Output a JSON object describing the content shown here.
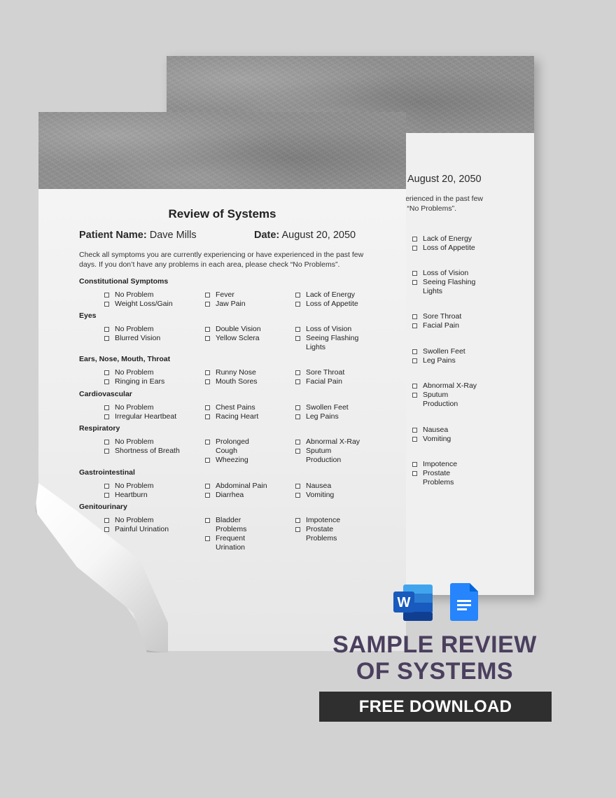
{
  "document": {
    "title": "Review of Systems",
    "patient_label": "Patient Name:",
    "patient_name": "Dave Mills",
    "date_label": "Date:",
    "date_value": "August 20, 2050",
    "instructions_line1": "Check all symptoms you are currently experiencing or have experienced in the past few",
    "instructions_line2": "days. If you don’t have any problems in each area, please check “No Problems”.",
    "sections": [
      {
        "heading": "Constitutional Symptoms",
        "col1": [
          "No Problem",
          "Weight Loss/Gain"
        ],
        "col2": [
          "Fever",
          "Jaw Pain"
        ],
        "col3": [
          "Lack of Energy",
          "Loss of Appetite"
        ]
      },
      {
        "heading": "Eyes",
        "col1": [
          "No Problem",
          "Blurred Vision"
        ],
        "col2": [
          "Double Vision",
          "Yellow Sclera"
        ],
        "col3": [
          "Loss of Vision",
          "Seeing Flashing Lights"
        ]
      },
      {
        "heading": "Ears, Nose, Mouth, Throat",
        "col1": [
          "No Problem",
          "Ringing in Ears"
        ],
        "col2": [
          "Runny Nose",
          "Mouth Sores"
        ],
        "col3": [
          "Sore Throat",
          "Facial Pain"
        ]
      },
      {
        "heading": "Cardiovascular",
        "col1": [
          "No Problem",
          "Irregular Heartbeat"
        ],
        "col2": [
          "Chest Pains",
          "Racing Heart"
        ],
        "col3": [
          "Swollen Feet",
          "Leg Pains"
        ]
      },
      {
        "heading": "Respiratory",
        "col1": [
          "No Problem",
          "Shortness of Breath"
        ],
        "col2": [
          "Prolonged Cough",
          "Wheezing"
        ],
        "col3": [
          "Abnormal X-Ray",
          "Sputum Production"
        ]
      },
      {
        "heading": "Gastrointestinal",
        "col1": [
          "No Problem",
          "Heartburn"
        ],
        "col2": [
          "Abdominal Pain",
          "Diarrhea"
        ],
        "col3": [
          "Nausea",
          "Vomiting"
        ]
      },
      {
        "heading": "Genitourinary",
        "col1": [
          "No Problem",
          "Painful Urination"
        ],
        "col2": [
          "Bladder Problems",
          "Frequent Urination"
        ],
        "col3": [
          "Impotence",
          "Prostate Problems"
        ]
      }
    ]
  },
  "back_page": {
    "date_value": "August 20, 2050",
    "instructions_line1": "xperienced in the past few",
    "instructions_line2": "ck “No Problems”.",
    "items": [
      "Lack of Energy",
      "Loss of Appetite",
      "Loss of Vision",
      "Seeing Flashing Lights",
      "Sore Throat",
      "Facial Pain",
      "Swollen Feet",
      "Leg Pains",
      "Abnormal X-Ray",
      "Sputum Production",
      "Nausea",
      "Vomiting",
      "Impotence",
      "Prostate Problems"
    ]
  },
  "promo": {
    "title_line1": "SAMPLE REVIEW",
    "title_line2": "OF SYSTEMS",
    "download_label": "FREE DOWNLOAD",
    "word_icon_letter": "W",
    "icons": [
      "microsoft-word-icon",
      "google-docs-icon"
    ],
    "colors": {
      "title": "#4b3f5e",
      "button_bg": "#2f2f2f",
      "word_blue": "#185abd",
      "gdocs_blue": "#2684fc"
    }
  }
}
